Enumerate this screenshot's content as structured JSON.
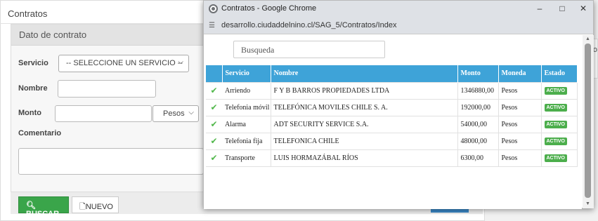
{
  "background": {
    "page_title": "Contratos",
    "box_title": "Dato de contrato",
    "servicio_label": "Servicio",
    "servicio_select": "-- SELECCIONE UN SERVICIO --",
    "nombre_label": "Nombre",
    "monto_label": "Monto",
    "moneda_select": "Pesos",
    "comentario_label": "Comentario",
    "buscar_button": "BUSCAR",
    "nuevo_button": "NUEVO",
    "right_fragment": "o"
  },
  "popup": {
    "window_title": "Contratos - Google Chrome",
    "url": "desarrollo.ciudaddelnino.cl/SAG_5/Contratos/Index",
    "search_placeholder": "Busqueda",
    "columns": [
      "Servicio",
      "Nombre",
      "Monto",
      "Moneda",
      "Estado"
    ],
    "rows": [
      {
        "servicio": "Arriendo",
        "nombre": "F Y B BARROS PROPIEDADES LTDA",
        "monto": "1346880,00",
        "moneda": "Pesos",
        "estado": "ACTIVO"
      },
      {
        "servicio": "Telefonia móvil",
        "nombre": "TELEFÓNICA MOVILES CHILE S. A.",
        "monto": "192000,00",
        "moneda": "Pesos",
        "estado": "ACTIVO"
      },
      {
        "servicio": "Alarma",
        "nombre": "ADT SECURITY SERVICE S.A.",
        "monto": "54000,00",
        "moneda": "Pesos",
        "estado": "ACTIVO"
      },
      {
        "servicio": "Telefonia fija",
        "nombre": "TELEFONICA CHILE",
        "monto": "48000,00",
        "moneda": "Pesos",
        "estado": "ACTIVO"
      },
      {
        "servicio": "Transporte",
        "nombre": "LUIS HORMAZÁBAL RÍOS",
        "monto": "6300,00",
        "moneda": "Pesos",
        "estado": "ACTIVO"
      }
    ]
  },
  "colors": {
    "header_blue": "#3ea3d8",
    "active_green": "#4cae4c",
    "buscar_green": "#3aa54a"
  }
}
